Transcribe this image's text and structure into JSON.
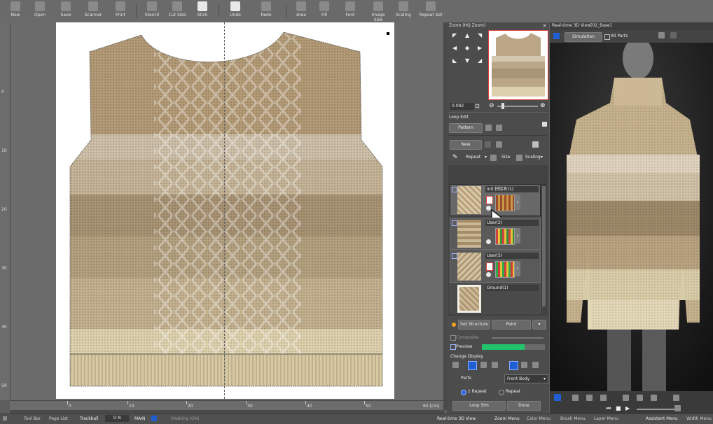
{
  "toolbar": {
    "items": [
      "New",
      "Open",
      "Save",
      "Scanner",
      "Print",
      "Stencil",
      "Cut Size",
      "Stick",
      "Undo",
      "Redo",
      "Area",
      "Fill",
      "Font",
      "Image Size",
      "Scaling",
      "Repeat Set"
    ]
  },
  "rulers": {
    "bottom_ticks": [
      "0",
      "10",
      "20",
      "30",
      "40",
      "50",
      "60 [cm]"
    ],
    "left_ticks": [
      "0",
      "10",
      "20",
      "30",
      "40",
      "50"
    ]
  },
  "zoom_panel": {
    "title": "Zoom (HQ Zoom)",
    "zoom_value": "0.092"
  },
  "loop_edit": {
    "title": "Loop Edit",
    "pattern_label": "Pattern",
    "new_label": "New",
    "repeat_label": "Repeat",
    "size_label": "Size",
    "scaling_label": "Scaling",
    "layers": [
      {
        "name": "Init 拼接名(1)"
      },
      {
        "name": "User(2)"
      },
      {
        "name": "User(5)"
      },
      {
        "name": "Ground(1)"
      }
    ],
    "set_structure_label": "Set Structure",
    "paint_label": "Paint",
    "composite_label": "Composite",
    "preview_label": "Preview",
    "preview_progress": 0.68,
    "change_display_label": "Change Display",
    "parts_label": "Parts",
    "parts_value": "Front Body",
    "repeat_option_1": "1 Repeat",
    "repeat_option_2": "Repeat",
    "loop_sim_label": "Loop Sim",
    "done_label": "Done"
  },
  "realtime_view": {
    "title": "Real-time 3D View[02_Base]",
    "simulation_label": "Simulation",
    "all_parts_label": "All Parts"
  },
  "statusbar": {
    "tool_bar": "Tool Bar",
    "page_list": "Page List",
    "trackball": "Trackball",
    "on_value": "O N",
    "main_value": "MAIN",
    "masking": "Masking (ON)",
    "menus": [
      "Real-time 3D View",
      "Zoom Menu",
      "Color Menu",
      "Brush Menu",
      "Layer Menu",
      "Assistant Menu",
      "Width Menu"
    ]
  },
  "colors": {
    "accent_blue": "#1f5fd1",
    "preview_green": "#22c36b",
    "set_structure_dot": "#f0a020",
    "selection_red": "#e0403a"
  }
}
